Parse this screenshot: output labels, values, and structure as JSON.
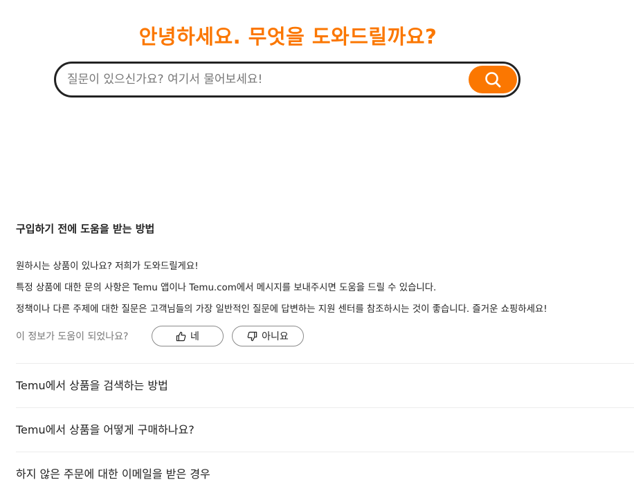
{
  "hero": {
    "title": "안녕하세요. 무엇을 도와드릴까요?"
  },
  "search": {
    "placeholder": "질문이 있으신가요? 여기서 물어보세요!",
    "icon": "search-icon",
    "button_color": "#fb7701"
  },
  "faq": {
    "open_item": {
      "question": "구입하기 전에 도움을 받는 방법",
      "answer_lines": [
        "원하시는 상품이 있나요? 저희가 도와드릴게요!",
        "특정 상품에 대한 문의 사항은 Temu 앱이나 Temu.com에서 메시지를 보내주시면 도움을 드릴 수 있습니다.",
        "정책이나 다른 주제에 대한 질문은 고객님들의 가장 일반적인 질문에 답변하는 지원 센터를 참조하시는 것이 좋습니다. 즐거운 쇼핑하세요!"
      ],
      "feedback": {
        "question": "이 정보가 도움이 되었나요?",
        "yes_label": "네",
        "yes_icon": "thumbs-up-icon",
        "no_label": "아니요",
        "no_icon": "thumbs-down-icon"
      }
    },
    "items": [
      {
        "label": "Temu에서 상품을 검색하는 방법"
      },
      {
        "label": "Temu에서 상품을 어떻게 구매하나요?"
      },
      {
        "label": "하지 않은 주문에 대한 이메일을 받은 경우"
      }
    ]
  },
  "colors": {
    "accent": "#fb7701",
    "text": "#222222",
    "muted": "#777777"
  }
}
